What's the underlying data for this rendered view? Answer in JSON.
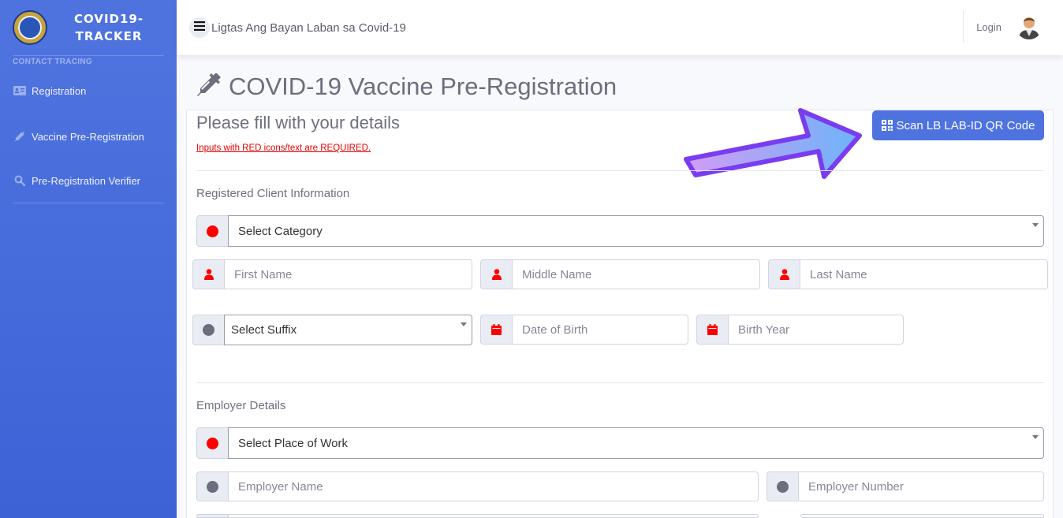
{
  "sidebar": {
    "brand_line1": "COVID19-",
    "brand_line2": "TRACKER",
    "heading": "CONTACT TRACING",
    "items": [
      {
        "label": "Registration",
        "icon": "id-card-icon"
      },
      {
        "label": "Vaccine Pre-Registration",
        "icon": "syringe-icon"
      },
      {
        "label": "Pre-Registration Verifier",
        "icon": "search-icon"
      }
    ]
  },
  "topbar": {
    "title": "Ligtas Ang Bayan Laban sa Covid-19",
    "login": "Login"
  },
  "page": {
    "heading": "COVID-19 Vaccine Pre-Registration",
    "card_title": "Please fill with your details",
    "required_note": "Inputs with RED icons/text are REQUIRED.",
    "scan_button": "Scan LB LAB-ID QR Code"
  },
  "sections": {
    "client": "Registered Client Information",
    "employer": "Employer Details"
  },
  "fields": {
    "category": "Select Category",
    "first_name": "First Name",
    "middle_name": "Middle Name",
    "last_name": "Last Name",
    "suffix": "Select Suffix",
    "dob": "Date of Birth",
    "birth_year": "Birth Year",
    "place_of_work": "Select Place of Work",
    "employer_name": "Employer Name",
    "employer_number": "Employer Number"
  },
  "colors": {
    "primary": "#4e73df",
    "required": "#ff0000",
    "optional": "#6c6e7e"
  }
}
